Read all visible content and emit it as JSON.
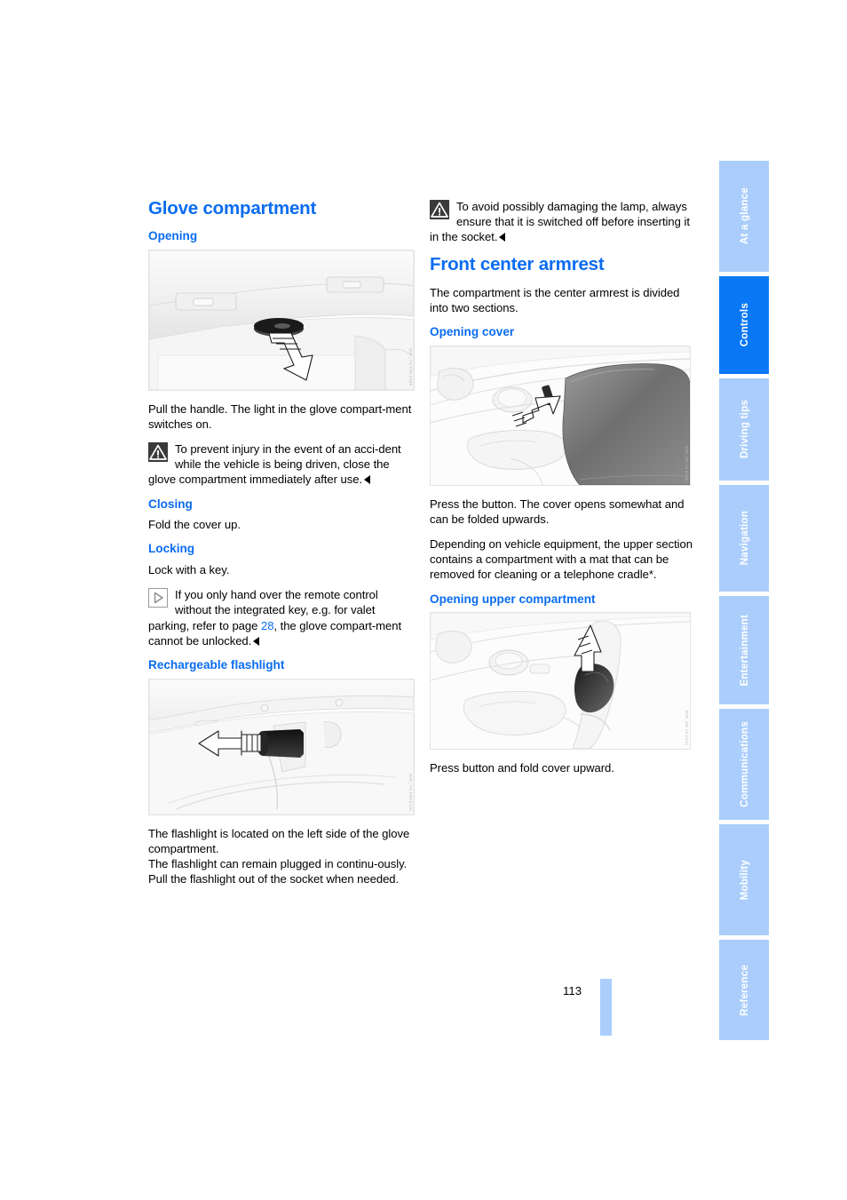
{
  "page": {
    "number": "113"
  },
  "left_column": {
    "chapter_title": "Glove compartment",
    "sections": [
      {
        "heading": "Opening",
        "figure_id": "fig-opening",
        "figure_code": "WIP_TH.F00.0109",
        "body": "Pull the handle. The light in the glove compart-ment switches on.",
        "note": {
          "icon": "warning-icon",
          "text": "To prevent injury in the event of an acci-dent while the vehicle is being driven, close the glove compartment immediately after use."
        }
      },
      {
        "heading": "Closing",
        "body": "Fold the cover up."
      },
      {
        "heading": "Locking",
        "body": "Lock with a key.",
        "note": {
          "icon": "info-icon",
          "text_part1": "If you only hand over the remote control without the integrated key, e.g. for valet parking, refer to page ",
          "page_link": "28",
          "text_part2": ", the glove compart-ment cannot be unlocked."
        }
      },
      {
        "heading": "Rechargeable flashlight",
        "figure_id": "fig-flashlight",
        "figure_code": "WIP_TH.F00.0110",
        "body1": "The flashlight is located on the left side of the glove compartment.",
        "body2": "The flashlight can remain plugged in continu-ously. Pull the flashlight out of the socket when needed."
      }
    ]
  },
  "right_column": {
    "top_note": {
      "icon": "warning-icon",
      "text": "To avoid possibly damaging the lamp, always ensure that it is switched off before inserting it in the socket."
    },
    "chapter_title": "Front center armrest",
    "intro": "The compartment is the center armrest is divided into two sections.",
    "sections": [
      {
        "heading": "Opening cover",
        "figure_id": "fig-cover",
        "figure_code": "WIP_DE.12.0140",
        "body1": "Press the button. The cover opens somewhat and can be folded upwards.",
        "body2": "Depending on vehicle equipment, the upper section contains a compartment with a mat that can be removed for cleaning or a telephone cradle*."
      },
      {
        "heading": "Opening upper compartment",
        "figure_id": "fig-upper",
        "figure_code": "WIP_DE.12.0141",
        "body": "Press button and fold cover upward."
      }
    ]
  },
  "tab_rail": {
    "tabs": [
      {
        "label": "At a glance",
        "active": false
      },
      {
        "label": "Controls",
        "active": true
      },
      {
        "label": "Driving tips",
        "active": false
      },
      {
        "label": "Navigation",
        "active": false
      },
      {
        "label": "Entertainment",
        "active": false
      },
      {
        "label": "Communications",
        "active": false
      },
      {
        "label": "Mobility",
        "active": false
      },
      {
        "label": "Reference",
        "active": false
      }
    ]
  },
  "colors": {
    "heading_blue": "#0a6cf0",
    "tab_active": "#0a78f5",
    "tab_inactive": "#aacdfb",
    "text": "#000000"
  }
}
